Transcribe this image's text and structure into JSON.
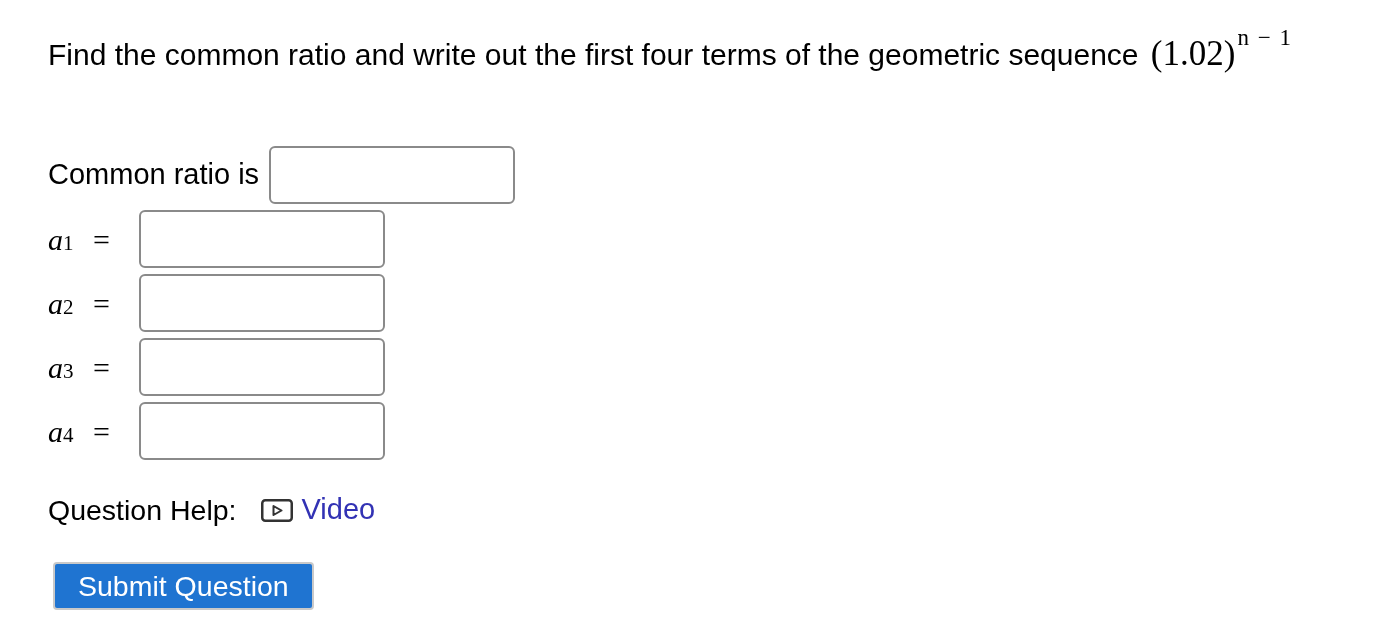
{
  "question": {
    "text": "Find the common ratio and write out the first four terms of the geometric sequence",
    "formula": "(1.02)$^{n − 1}$"
  },
  "ratio": {
    "label": "Common ratio is"
  },
  "terms": [
    {
      "label": "*a*$_{1}$ ="
    },
    {
      "label": "*a*$_{2}$ ="
    },
    {
      "label": "*a*$_{3}$ ="
    },
    {
      "label": "*a*$_{4}$ ="
    }
  ],
  "help": {
    "label": "Question Help:",
    "link": "Video"
  },
  "submit": {
    "label": "Submit Question"
  }
}
